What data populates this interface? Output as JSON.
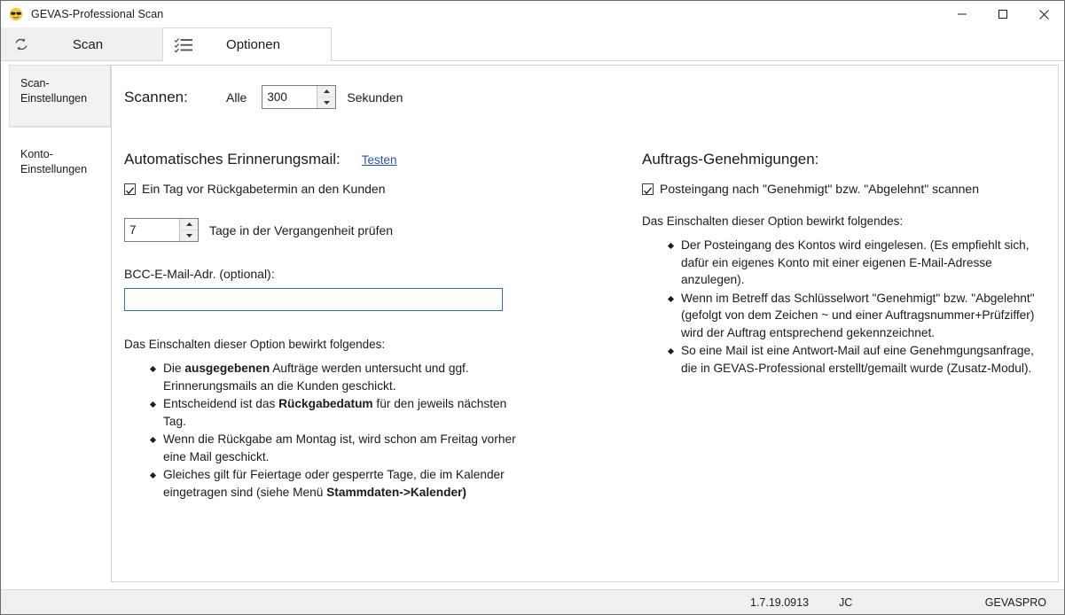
{
  "window": {
    "title": "GEVAS-Professional Scan",
    "app_icon": "sunglasses-face-icon",
    "controls": {
      "minimize": "minimize-icon",
      "maximize": "maximize-icon",
      "close": "close-icon"
    }
  },
  "tabs": [
    {
      "label": "Scan",
      "icon": "refresh-sync-icon",
      "active": false
    },
    {
      "label": "Optionen",
      "icon": "checklist-icon",
      "active": true
    }
  ],
  "sidebar": {
    "items": [
      {
        "label": "Scan-Einstellungen",
        "selected": true
      },
      {
        "label": "Konto-Einstellungen",
        "selected": false
      }
    ]
  },
  "scannen": {
    "label": "Scannen:",
    "every_label": "Alle",
    "interval_value": "300",
    "unit_label": "Sekunden",
    "spin_up_icon": "caret-up-icon",
    "spin_down_icon": "caret-down-icon"
  },
  "left_column": {
    "heading": "Automatisches Erinnerungsmail:",
    "test_link": "Testen",
    "checkbox": {
      "label": "Ein Tag vor Rückgabetermin an den Kunden",
      "checked": true
    },
    "days_value": "7",
    "days_label": "Tage in der Vergangenheit prüfen",
    "bcc_label": "BCC-E-Mail-Adr. (optional):",
    "bcc_value": "",
    "bcc_placeholder": "",
    "note_intro": "Das Einschalten dieser Option bewirkt folgendes:",
    "bullets": [
      {
        "parts": [
          {
            "t": "Die "
          },
          {
            "t": "ausgegebenen",
            "b": true
          },
          {
            "t": " Aufträge werden untersucht und ggf. Erinnerungsmails an die Kunden geschickt."
          }
        ]
      },
      {
        "parts": [
          {
            "t": "Entscheidend ist das "
          },
          {
            "t": "Rückgabedatum",
            "b": true
          },
          {
            "t": " für den jeweils nächsten Tag."
          }
        ]
      },
      {
        "parts": [
          {
            "t": "Wenn die Rückgabe am Montag ist, wird schon am Freitag vorher eine Mail geschickt."
          }
        ]
      },
      {
        "parts": [
          {
            "t": "Gleiches gilt für Feiertage oder gesperrte Tage, die im Kalender eingetragen sind (siehe Menü "
          },
          {
            "t": "Stammdaten->Kalender)",
            "b": true
          }
        ]
      }
    ]
  },
  "right_column": {
    "heading": "Auftrags-Genehmigungen:",
    "checkbox": {
      "label": "Posteingang nach \"Genehmigt\" bzw. \"Abgelehnt\" scannen",
      "checked": true
    },
    "note_intro": "Das Einschalten dieser Option bewirkt folgendes:",
    "bullets": [
      {
        "parts": [
          {
            "t": "Der Posteingang des Kontos wird eingelesen. (Es empfiehlt sich, dafür ein eigenes Konto mit einer eigenen E-Mail-Adresse anzulegen)."
          }
        ]
      },
      {
        "parts": [
          {
            "t": "Wenn im Betreff das Schlüsselwort \"Genehmigt\" bzw. \"Abgelehnt\" (gefolgt von dem Zeichen ~ und einer Auftragsnummer+Prüfziffer) wird der Auftrag entsprechend gekennzeichnet."
          }
        ]
      },
      {
        "parts": [
          {
            "t": "So eine Mail ist eine Antwort-Mail auf eine Genehmgungsanfrage, die in GEVAS-Professional erstellt/gemailt wurde (Zusatz-Modul)."
          }
        ]
      }
    ]
  },
  "statusbar": {
    "version": "1.7.19.0913",
    "user": "JC",
    "database": "GEVASPRO"
  },
  "colors": {
    "link": "#2a4fae",
    "input_border": "#3c6ea5",
    "tab_inactive_bg": "#f0f0f0",
    "sidebar_selected_bg": "#f2f2f2",
    "statusbar_bg": "#f0f0f0"
  }
}
